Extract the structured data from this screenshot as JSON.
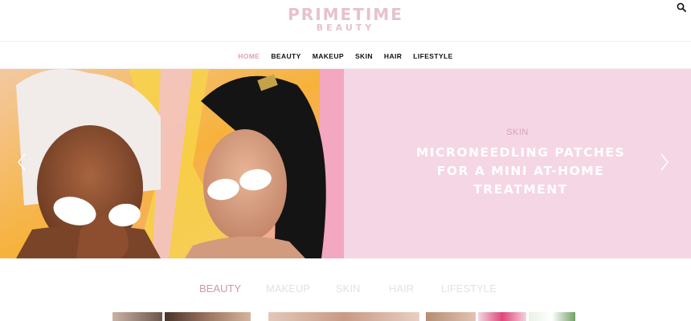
{
  "header": {
    "logo_main": "PRIMETIME",
    "logo_sub": "BEAUTY",
    "search_icon": "search-icon"
  },
  "nav": {
    "items": [
      {
        "label": "HOME",
        "active": true
      },
      {
        "label": "BEAUTY",
        "active": false
      },
      {
        "label": "MAKEUP",
        "active": false
      },
      {
        "label": "SKIN",
        "active": false
      },
      {
        "label": "HAIR",
        "active": false
      },
      {
        "label": "LIFESTYLE",
        "active": false
      }
    ]
  },
  "hero": {
    "category": "SKIN",
    "title": "MICRONEEDLING PATCHES FOR A MINI AT-HOME TREATMENT",
    "prev_icon": "chevron-left-icon",
    "next_icon": "chevron-right-icon"
  },
  "tabs": {
    "items": [
      {
        "label": "BEAUTY",
        "active": true
      },
      {
        "label": "MAKEUP",
        "active": false
      },
      {
        "label": "SKIN",
        "active": false
      },
      {
        "label": "HAIR",
        "active": false
      },
      {
        "label": "LIFESTYLE",
        "active": false
      }
    ]
  },
  "colors": {
    "accent_pink": "#d9a1b5",
    "logo_pink": "#e7c1cf",
    "panel_pink": "#f5d6e4",
    "tab_active": "#cc98b0",
    "tab_inactive": "#e7e0e3"
  }
}
